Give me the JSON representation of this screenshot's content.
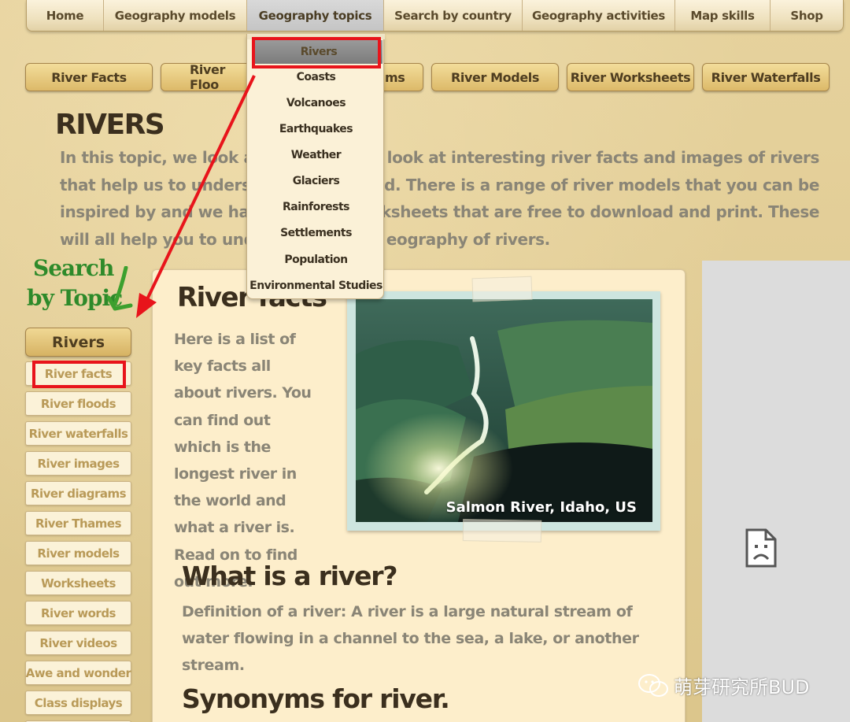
{
  "top_nav": {
    "items": [
      {
        "label": "Home"
      },
      {
        "label": "Geography models"
      },
      {
        "label": "Geography topics"
      },
      {
        "label": "Search by country"
      },
      {
        "label": "Geography activities"
      },
      {
        "label": "Map skills"
      },
      {
        "label": "Shop"
      }
    ],
    "active_index": 2
  },
  "dropdown": {
    "items": [
      {
        "label": "Rivers"
      },
      {
        "label": "Coasts"
      },
      {
        "label": "Volcanoes"
      },
      {
        "label": "Earthquakes"
      },
      {
        "label": "Weather"
      },
      {
        "label": "Glaciers"
      },
      {
        "label": "Rainforests"
      },
      {
        "label": "Settlements"
      },
      {
        "label": "Population"
      },
      {
        "label": "Environmental Studies"
      }
    ],
    "highlighted_index": 0
  },
  "sub_nav": {
    "items": [
      {
        "label": "River Facts"
      },
      {
        "label": "River Floo"
      },
      {
        "label": "ms"
      },
      {
        "label": "River Models"
      },
      {
        "label": "River Worksheets"
      },
      {
        "label": "River Waterfalls"
      }
    ]
  },
  "page": {
    "title": "RIVERS",
    "intro_lines": [
      "In this topic, we look at th",
      "vers. We look at interesting river facts and images of rivers",
      "that help us to understan",
      "the land. There is a range of river models that you can be",
      "inspired by and we have a",
      "e of worksheets that are free to download and print. These",
      "will all help you to underst",
      "eography of rivers."
    ]
  },
  "search_by_topic": {
    "line1": "Search",
    "line2": "by Topic"
  },
  "sidebar": {
    "header": "Rivers",
    "items": [
      {
        "label": "River facts"
      },
      {
        "label": "River floods"
      },
      {
        "label": "River waterfalls"
      },
      {
        "label": "River images"
      },
      {
        "label": "River diagrams"
      },
      {
        "label": "River Thames"
      },
      {
        "label": "River models"
      },
      {
        "label": "Worksheets"
      },
      {
        "label": "River words"
      },
      {
        "label": "River videos"
      },
      {
        "label": "Awe and wonder"
      },
      {
        "label": "Class displays"
      }
    ]
  },
  "main": {
    "section_title": "River facts",
    "intro_text": "Here is a list of key facts all about rivers. You can find out which is the longest river in the world and what a river is. Read on to find out more.",
    "photo_caption": "Salmon River, Idaho, US",
    "h2_what": "What is a river?",
    "definition": "Definition of a river: A river is a large natural stream of water flowing in a channel to the sea, a lake, or another stream.",
    "h2_synonyms": "Synonyms for river."
  },
  "watermark": {
    "text": "萌芽研究所BUD"
  },
  "colors": {
    "annotation_red": "#e8141b",
    "search_green": "#2e8a2a",
    "page_bg": "#e2cd96",
    "panel_bg": "#fdeecb"
  }
}
